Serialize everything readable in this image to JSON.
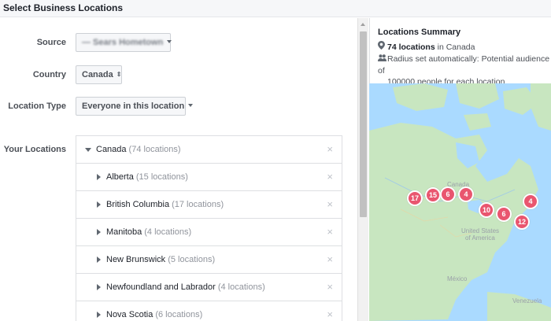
{
  "page": {
    "title": "Select Business Locations"
  },
  "form": {
    "source": {
      "label": "Source",
      "value": "— Sears Hometown"
    },
    "country": {
      "label": "Country",
      "value": "Canada"
    },
    "location_type": {
      "label": "Location Type",
      "value": "Everyone in this location"
    },
    "your_locations": {
      "label": "Your Locations"
    }
  },
  "locations": {
    "root": {
      "name": "Canada",
      "count": "(74 locations)"
    },
    "children": [
      {
        "name": "Alberta",
        "count": "(15 locations)"
      },
      {
        "name": "British Columbia",
        "count": "(17 locations)"
      },
      {
        "name": "Manitoba",
        "count": "(4 locations)"
      },
      {
        "name": "New Brunswick",
        "count": "(5 locations)"
      },
      {
        "name": "Newfoundland and Labrador",
        "count": "(4 locations)"
      },
      {
        "name": "Nova Scotia",
        "count": "(6 locations)"
      }
    ],
    "remove_glyph": "×"
  },
  "summary": {
    "title": "Locations Summary",
    "locations_bold": "74 locations",
    "locations_rest": " in Canada",
    "radius_line1": "Radius set automatically: Potential audience of",
    "radius_line2": "100000 people for each location"
  },
  "map": {
    "labels": {
      "canada": "Canada",
      "us1": "United States",
      "us2": "of America",
      "mexico": "México",
      "venezuela": "Venezuela"
    },
    "pins": [
      "17",
      "15",
      "6",
      "4",
      "10",
      "6",
      "4",
      "12"
    ]
  },
  "colors": {
    "pin": "#e9566f",
    "water": "#aadaff",
    "land": "#c8e6c0",
    "accent": "#4267b2"
  }
}
